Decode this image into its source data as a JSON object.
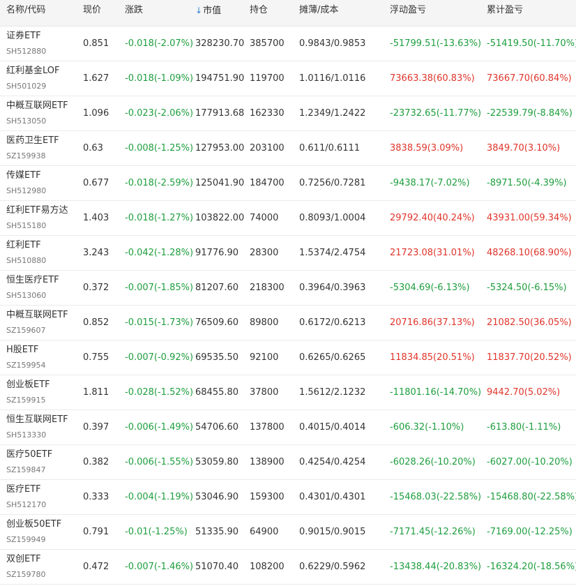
{
  "columns": {
    "name": "名称/代码",
    "price": "现价",
    "change": "涨跌",
    "market_value": "市值",
    "holding": "持仓",
    "cost": "摊薄/成本",
    "floating_pl": "浮动盈亏",
    "accumulated_pl": "累计盈亏"
  },
  "sort_icon": "down-arrow-icon",
  "colors": {
    "up": "#e0352b",
    "down": "#1e9e3e",
    "sort": "#2d7cd6"
  },
  "rows": [
    {
      "name": "证券ETF",
      "code": "SH512880",
      "price": "0.851",
      "change": "-0.018(-2.07%)",
      "market_value": "328230.70",
      "holding": "385700",
      "cost": "0.9843/0.9853",
      "floating_pl": "-51799.51(-13.63%)",
      "floating_dir": "down",
      "accumulated_pl": "-51419.50(-11.70%)",
      "accumulated_dir": "down"
    },
    {
      "name": "红利基金LOF",
      "code": "SH501029",
      "price": "1.627",
      "change": "-0.018(-1.09%)",
      "market_value": "194751.90",
      "holding": "119700",
      "cost": "1.0116/1.0116",
      "floating_pl": "73663.38(60.83%)",
      "floating_dir": "up",
      "accumulated_pl": "73667.70(60.84%)",
      "accumulated_dir": "up"
    },
    {
      "name": "中概互联网ETF",
      "code": "SH513050",
      "price": "1.096",
      "change": "-0.023(-2.06%)",
      "market_value": "177913.68",
      "holding": "162330",
      "cost": "1.2349/1.2422",
      "floating_pl": "-23732.65(-11.77%)",
      "floating_dir": "down",
      "accumulated_pl": "-22539.79(-8.84%)",
      "accumulated_dir": "down"
    },
    {
      "name": "医药卫生ETF",
      "code": "SZ159938",
      "price": "0.63",
      "change": "-0.008(-1.25%)",
      "market_value": "127953.00",
      "holding": "203100",
      "cost": "0.611/0.6111",
      "floating_pl": "3838.59(3.09%)",
      "floating_dir": "up",
      "accumulated_pl": "3849.70(3.10%)",
      "accumulated_dir": "up"
    },
    {
      "name": "传媒ETF",
      "code": "SH512980",
      "price": "0.677",
      "change": "-0.018(-2.59%)",
      "market_value": "125041.90",
      "holding": "184700",
      "cost": "0.7256/0.7281",
      "floating_pl": "-9438.17(-7.02%)",
      "floating_dir": "down",
      "accumulated_pl": "-8971.50(-4.39%)",
      "accumulated_dir": "down"
    },
    {
      "name": "红利ETF易方达",
      "code": "SH515180",
      "price": "1.403",
      "change": "-0.018(-1.27%)",
      "market_value": "103822.00",
      "holding": "74000",
      "cost": "0.8093/1.0004",
      "floating_pl": "29792.40(40.24%)",
      "floating_dir": "up",
      "accumulated_pl": "43931.00(59.34%)",
      "accumulated_dir": "up"
    },
    {
      "name": "红利ETF",
      "code": "SH510880",
      "price": "3.243",
      "change": "-0.042(-1.28%)",
      "market_value": "91776.90",
      "holding": "28300",
      "cost": "1.5374/2.4754",
      "floating_pl": "21723.08(31.01%)",
      "floating_dir": "up",
      "accumulated_pl": "48268.10(68.90%)",
      "accumulated_dir": "up"
    },
    {
      "name": "恒生医疗ETF",
      "code": "SH513060",
      "price": "0.372",
      "change": "-0.007(-1.85%)",
      "market_value": "81207.60",
      "holding": "218300",
      "cost": "0.3964/0.3963",
      "floating_pl": "-5304.69(-6.13%)",
      "floating_dir": "down",
      "accumulated_pl": "-5324.50(-6.15%)",
      "accumulated_dir": "down"
    },
    {
      "name": "中概互联网ETF",
      "code": "SZ159607",
      "price": "0.852",
      "change": "-0.015(-1.73%)",
      "market_value": "76509.60",
      "holding": "89800",
      "cost": "0.6172/0.6213",
      "floating_pl": "20716.86(37.13%)",
      "floating_dir": "up",
      "accumulated_pl": "21082.50(36.05%)",
      "accumulated_dir": "up"
    },
    {
      "name": "H股ETF",
      "code": "SZ159954",
      "price": "0.755",
      "change": "-0.007(-0.92%)",
      "market_value": "69535.50",
      "holding": "92100",
      "cost": "0.6265/0.6265",
      "floating_pl": "11834.85(20.51%)",
      "floating_dir": "up",
      "accumulated_pl": "11837.70(20.52%)",
      "accumulated_dir": "up"
    },
    {
      "name": "创业板ETF",
      "code": "SZ159915",
      "price": "1.811",
      "change": "-0.028(-1.52%)",
      "market_value": "68455.80",
      "holding": "37800",
      "cost": "1.5612/2.1232",
      "floating_pl": "-11801.16(-14.70%)",
      "floating_dir": "down",
      "accumulated_pl": "9442.70(5.02%)",
      "accumulated_dir": "up"
    },
    {
      "name": "恒生互联网ETF",
      "code": "SH513330",
      "price": "0.397",
      "change": "-0.006(-1.49%)",
      "market_value": "54706.60",
      "holding": "137800",
      "cost": "0.4015/0.4014",
      "floating_pl": "-606.32(-1.10%)",
      "floating_dir": "down",
      "accumulated_pl": "-613.80(-1.11%)",
      "accumulated_dir": "down"
    },
    {
      "name": "医疗50ETF",
      "code": "SZ159847",
      "price": "0.382",
      "change": "-0.006(-1.55%)",
      "market_value": "53059.80",
      "holding": "138900",
      "cost": "0.4254/0.4254",
      "floating_pl": "-6028.26(-10.20%)",
      "floating_dir": "down",
      "accumulated_pl": "-6027.00(-10.20%)",
      "accumulated_dir": "down"
    },
    {
      "name": "医疗ETF",
      "code": "SH512170",
      "price": "0.333",
      "change": "-0.004(-1.19%)",
      "market_value": "53046.90",
      "holding": "159300",
      "cost": "0.4301/0.4301",
      "floating_pl": "-15468.03(-22.58%)",
      "floating_dir": "down",
      "accumulated_pl": "-15468.80(-22.58%)",
      "accumulated_dir": "down"
    },
    {
      "name": "创业板50ETF",
      "code": "SZ159949",
      "price": "0.791",
      "change": "-0.01(-1.25%)",
      "market_value": "51335.90",
      "holding": "64900",
      "cost": "0.9015/0.9015",
      "floating_pl": "-7171.45(-12.26%)",
      "floating_dir": "down",
      "accumulated_pl": "-7169.00(-12.25%)",
      "accumulated_dir": "down"
    },
    {
      "name": "双创ETF",
      "code": "SZ159780",
      "price": "0.472",
      "change": "-0.007(-1.46%)",
      "market_value": "51070.40",
      "holding": "108200",
      "cost": "0.6229/0.5962",
      "floating_pl": "-13438.44(-20.83%)",
      "floating_dir": "down",
      "accumulated_pl": "-16324.20(-18.56%)",
      "accumulated_dir": "down"
    }
  ]
}
